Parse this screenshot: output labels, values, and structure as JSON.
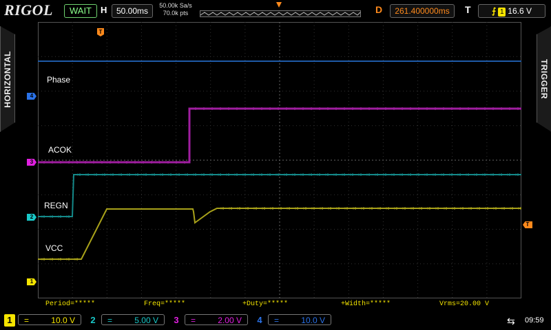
{
  "header": {
    "brand": "RIGOL",
    "run_status": "WAIT",
    "horizontal_label": "H",
    "timebase": "50.00ms",
    "sample_rate": "50.00k Sa/s",
    "memory_depth": "70.0k pts",
    "delay_label": "D",
    "delay_value": "261.400000ms",
    "trigger_label": "T",
    "trigger_channel": "1",
    "trigger_level": "16.6 V",
    "trigger_edge_icon": "rising-edge-icon"
  },
  "side_panels": {
    "left": "HORIZONTAL",
    "right": "TRIGGER"
  },
  "markers": {
    "ch1": "1",
    "ch2": "2",
    "ch3": "3",
    "ch4": "4",
    "trigger": "T"
  },
  "signal_labels": {
    "phase": "Phase",
    "acok": "ACOK",
    "regn": "REGN",
    "vcc": "VCC"
  },
  "measurements": {
    "period": "Period=*****",
    "freq": "Freq=*****",
    "duty": "+Duty=*****",
    "width": "+Width=*****",
    "vrms": "Vrms=20.00 V"
  },
  "channels": [
    {
      "num": "1",
      "coupling": "=",
      "scale": "10.0 V",
      "color": "#f5e400"
    },
    {
      "num": "2",
      "coupling": "=",
      "scale": "5.00 V",
      "color": "#19c8c8"
    },
    {
      "num": "3",
      "coupling": "=",
      "scale": "2.00 V",
      "color": "#e020e0"
    },
    {
      "num": "4",
      "coupling": "=",
      "scale": "10.0 V",
      "color": "#2a72e8"
    }
  ],
  "status_bar": {
    "usb_icon": "usb-icon",
    "time": "09:59"
  },
  "colors": {
    "ch1": "#a9a21a",
    "ch2": "#148a8a",
    "ch3": "#a01ea0",
    "ch4": "#1e5aa8",
    "trigger": "#ff8a1c",
    "status_ok": "#6fd36f"
  }
}
